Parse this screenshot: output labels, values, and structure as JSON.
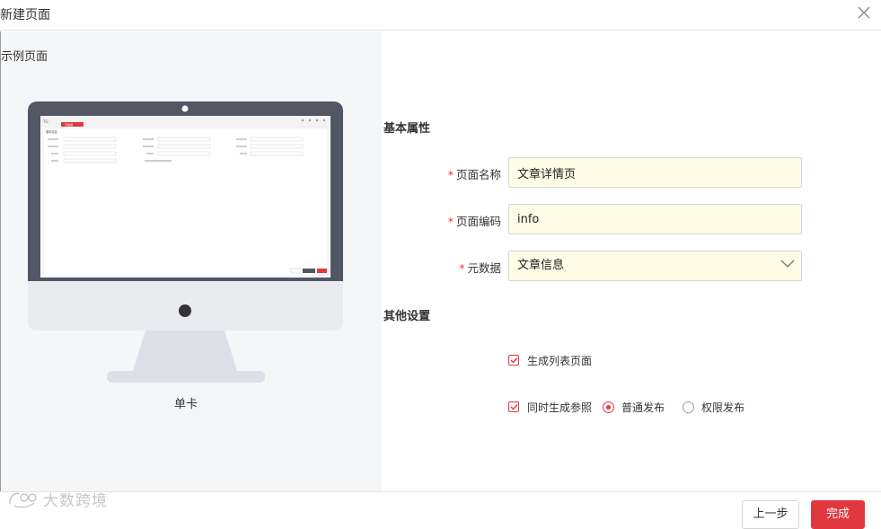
{
  "dialog": {
    "title": "新建页面"
  },
  "preview": {
    "label": "示例页面",
    "caption": "单卡",
    "mini_ui": {
      "logo": "TG",
      "tab": "元数据",
      "panel_title": "基本信息"
    }
  },
  "basic": {
    "title": "基本属性",
    "page_name_label": "页面名称",
    "page_name_value": "文章详情页",
    "page_code_label": "页面编码",
    "page_code_value": "info",
    "metadata_label": "元数据",
    "metadata_value": "文章信息"
  },
  "other": {
    "title": "其他设置",
    "gen_list_label": "生成列表页面",
    "gen_ref_label": "同时生成参照",
    "publish_normal": "普通发布",
    "publish_permission": "权限发布"
  },
  "footer": {
    "prev": "上一步",
    "done": "完成"
  },
  "watermark": {
    "text": "大数跨境"
  },
  "colors": {
    "accent": "#e0383e",
    "input_bg": "#fffbe6",
    "monitor": "#535663",
    "pane_bg": "#f5f6f8"
  }
}
